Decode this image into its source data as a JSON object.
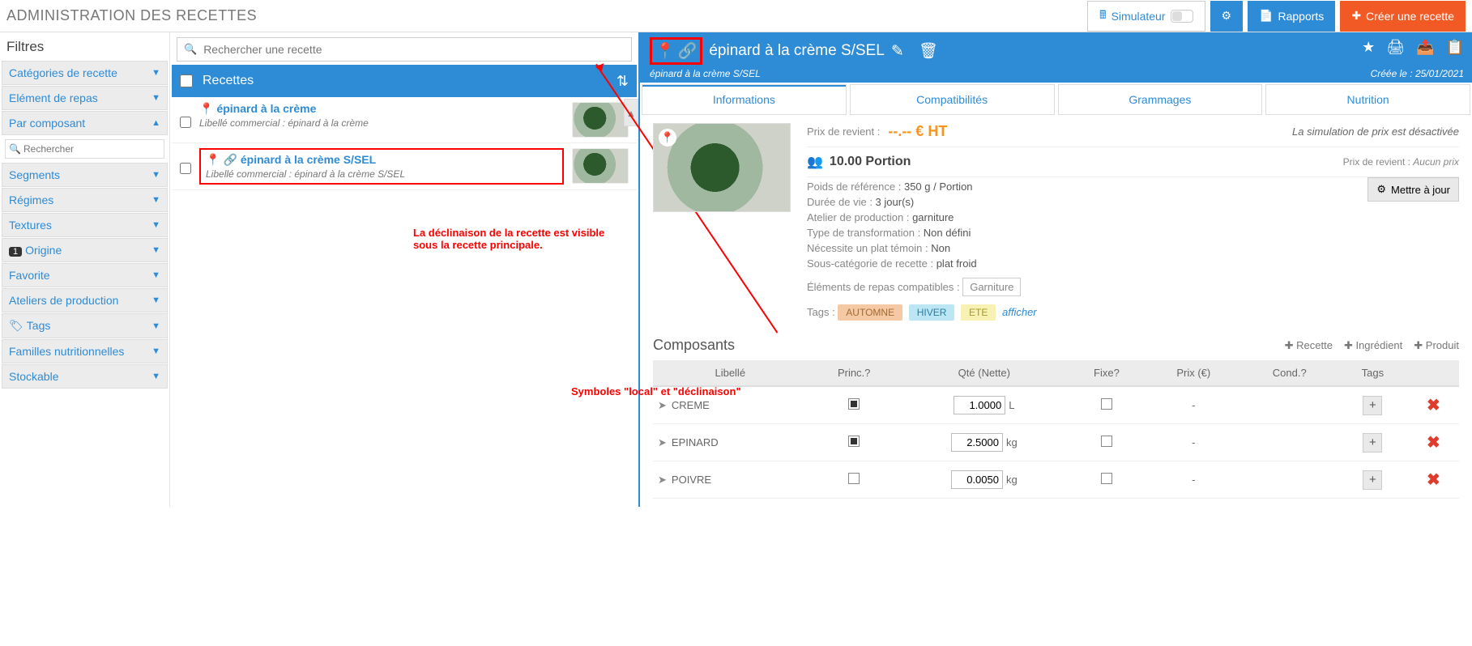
{
  "page": {
    "title": "ADMINISTRATION DES RECETTES"
  },
  "toolbar": {
    "simulateur": "Simulateur",
    "rapports": "Rapports",
    "creer": "Créer une recette"
  },
  "sidebar": {
    "filtres": "Filtres",
    "search_placeholder": "Rechercher",
    "categories": "Catégories de recette",
    "element": "Elément de repas",
    "composant": "Par composant",
    "segments": "Segments",
    "regimes": "Régimes",
    "textures": "Textures",
    "origine": "Origine",
    "origine_count": "1",
    "favorite": "Favorite",
    "ateliers": "Ateliers de production",
    "tags": "Tags",
    "familles": "Familles nutritionnelles",
    "stockable": "Stockable"
  },
  "middle": {
    "search_placeholder": "Rechercher une recette",
    "header": "Recettes",
    "row1": {
      "name": "épinard à la crème",
      "com": "Libellé commercial : épinard à la crème"
    },
    "row2": {
      "name": "épinard à la crème S/SEL",
      "com": "Libellé commercial : épinard à la crème S/SEL"
    },
    "anno1": "La déclinaison de la recette est visible sous la recette principale.",
    "anno2": "Symboles \"local\" et \"déclinaison\""
  },
  "detail": {
    "title": "épinard à la crème S/SEL",
    "subtitle": "épinard à la crème S/SEL",
    "created": "Créée le : 25/01/2021",
    "tabs": {
      "info": "Informations",
      "compat": "Compatibilités",
      "gram": "Grammages",
      "nutri": "Nutrition"
    },
    "prix_label": "Prix de revient :",
    "prix_value": "--.--   € HT",
    "prix_note": "La simulation de prix est désactivée",
    "portion": "10.00 Portion",
    "prix_revient_lab": "Prix de revient :",
    "prix_revient_val": "Aucun prix",
    "poids": "Poids de référence : ",
    "poids_val": "350 g / Portion",
    "duree": "Durée de vie : ",
    "duree_val": "3 jour(s)",
    "atelier": "Atelier de production : ",
    "atelier_val": "garniture",
    "transfo": "Type de transformation : ",
    "transfo_val": "Non défini",
    "temoin": "Nécessite un plat témoin : ",
    "temoin_val": "Non",
    "souscat": "Sous-catégorie de recette : ",
    "souscat_val": "plat froid",
    "repas": "Éléments de repas compatibles : ",
    "repas_val": "Garniture",
    "tags_lab": "Tags : ",
    "tag_automne": "AUTOMNE",
    "tag_hiver": "HIVER",
    "tag_ete": "ETE",
    "afficher": "afficher",
    "update": "Mettre à jour"
  },
  "composants": {
    "title": "Composants",
    "add_recette": "Recette",
    "add_ingredient": "Ingrédient",
    "add_produit": "Produit",
    "th": {
      "libelle": "Libellé",
      "princ": "Princ.?",
      "qte": "Qté (Nette)",
      "fixe": "Fixe?",
      "prix": "Prix (€)",
      "cond": "Cond.?",
      "tags": "Tags"
    },
    "rows": [
      {
        "lib": "CREME",
        "princ": true,
        "qte": "1.0000",
        "unit": "L",
        "fixe": false,
        "prix": "-"
      },
      {
        "lib": "EPINARD",
        "princ": true,
        "qte": "2.5000",
        "unit": "kg",
        "fixe": false,
        "prix": "-"
      },
      {
        "lib": "POIVRE",
        "princ": false,
        "qte": "0.0050",
        "unit": "kg",
        "fixe": false,
        "prix": "-"
      }
    ]
  }
}
